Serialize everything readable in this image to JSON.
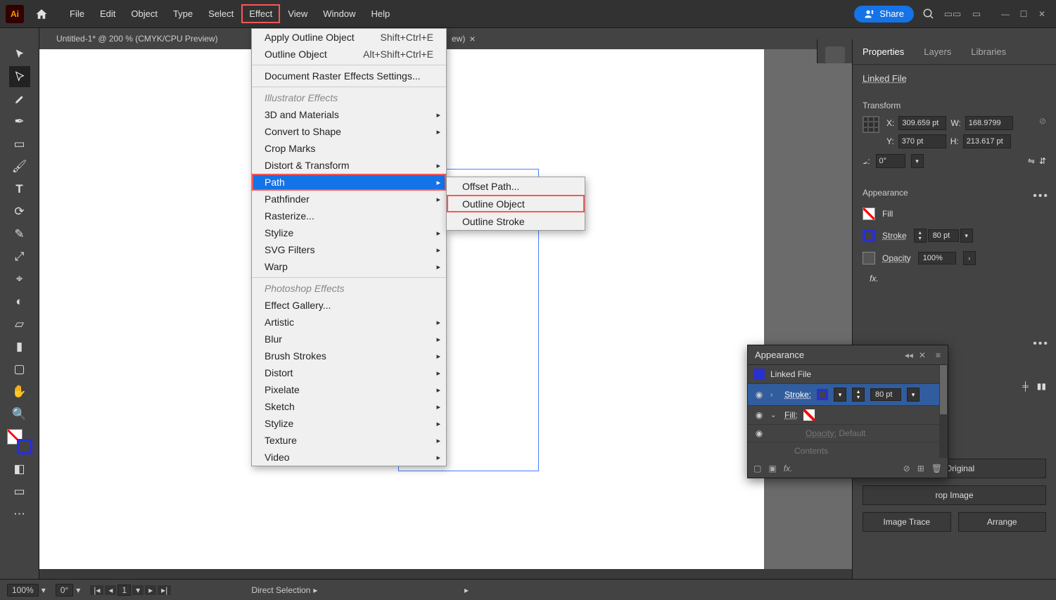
{
  "menubar": {
    "items": [
      "File",
      "Edit",
      "Object",
      "Type",
      "Select",
      "Effect",
      "View",
      "Window",
      "Help"
    ],
    "highlighted_index": 5,
    "share_label": "Share"
  },
  "document": {
    "tab_label": "Untitled-1* @ 200 % (CMYK/CPU Preview)",
    "tab_suffix": "ew)"
  },
  "effect_menu": {
    "top": [
      {
        "label": "Apply Outline Object",
        "shortcut": "Shift+Ctrl+E"
      },
      {
        "label": "Outline Object",
        "shortcut": "Alt+Shift+Ctrl+E"
      }
    ],
    "raster_settings": "Document Raster Effects Settings...",
    "illustrator_header": "Illustrator Effects",
    "illustrator_items": [
      {
        "label": "3D and Materials",
        "sub": true
      },
      {
        "label": "Convert to Shape",
        "sub": true
      },
      {
        "label": "Crop Marks",
        "sub": false
      },
      {
        "label": "Distort & Transform",
        "sub": true
      },
      {
        "label": "Path",
        "sub": true,
        "selected": true,
        "boxed": true
      },
      {
        "label": "Pathfinder",
        "sub": true
      },
      {
        "label": "Rasterize...",
        "sub": false
      },
      {
        "label": "Stylize",
        "sub": true
      },
      {
        "label": "SVG Filters",
        "sub": true
      },
      {
        "label": "Warp",
        "sub": true
      }
    ],
    "photoshop_header": "Photoshop Effects",
    "photoshop_items": [
      {
        "label": "Effect Gallery...",
        "sub": false
      },
      {
        "label": "Artistic",
        "sub": true
      },
      {
        "label": "Blur",
        "sub": true
      },
      {
        "label": "Brush Strokes",
        "sub": true
      },
      {
        "label": "Distort",
        "sub": true
      },
      {
        "label": "Pixelate",
        "sub": true
      },
      {
        "label": "Sketch",
        "sub": true
      },
      {
        "label": "Stylize",
        "sub": true
      },
      {
        "label": "Texture",
        "sub": true
      },
      {
        "label": "Video",
        "sub": true
      }
    ]
  },
  "path_submenu": {
    "items": [
      {
        "label": "Offset Path..."
      },
      {
        "label": "Outline Object",
        "boxed": true
      },
      {
        "label": "Outline Stroke"
      }
    ]
  },
  "properties": {
    "tabs": [
      "Properties",
      "Layers",
      "Libraries"
    ],
    "linked_file": "Linked File",
    "transform": {
      "title": "Transform",
      "x_label": "X:",
      "x": "309.659 pt",
      "y_label": "Y:",
      "y": "370 pt",
      "w_label": "W:",
      "w": "168.9799 ",
      "h_label": "H:",
      "h": "213.617 pt",
      "rot_label": "⦟:",
      "rot": "0°"
    },
    "appearance": {
      "title": "Appearance",
      "fill_label": "Fill",
      "stroke_label": "Stroke",
      "stroke_val": "80 pt",
      "opacity_label": "Opacity",
      "opacity_val": "100%"
    },
    "buttons": {
      "edit_original": "dit Original",
      "crop_image": "rop Image",
      "image_trace": "Image Trace",
      "arrange": "Arrange"
    }
  },
  "appearance_panel": {
    "title": "Appearance",
    "linked_file": "Linked File",
    "stroke_label": "Stroke:",
    "stroke_val": "80 pt",
    "fill_label": "Fill:",
    "opacity_label": "Opacity:",
    "opacity_val": "Default",
    "contents": "Contents"
  },
  "statusbar": {
    "zoom": "100%",
    "rotation": "0°",
    "artboard": "1",
    "tool": "Direct Selection"
  }
}
